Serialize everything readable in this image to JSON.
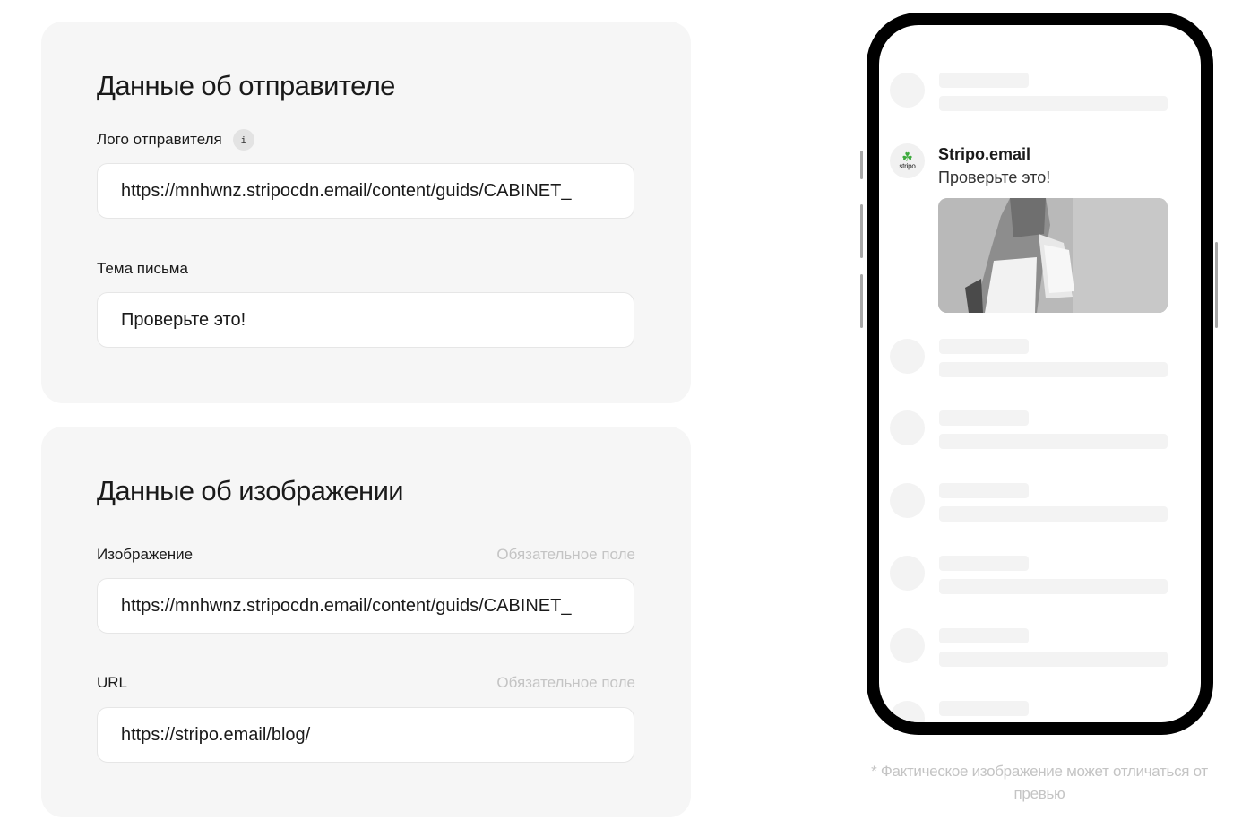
{
  "sender_section": {
    "title": "Данные об отправителе",
    "logo_label": "Лого отправителя",
    "logo_info_icon": "i",
    "logo_url": "https://mnhwnz.stripocdn.email/content/guids/CABINET_",
    "subject_label": "Тема письма",
    "subject_value": "Проверьте это!"
  },
  "image_section": {
    "title": "Данные об изображении",
    "image_label": "Изображение",
    "image_required": "Обязательное поле",
    "image_url": "https://mnhwnz.stripocdn.email/content/guids/CABINET_",
    "url_label": "URL",
    "url_required": "Обязательное поле",
    "url_value": "https://stripo.email/blog/"
  },
  "preview": {
    "sender_name": "Stripo.email",
    "subject": "Проверьте это!",
    "logo_text": "stripo",
    "logo_icon": "leaf-icon",
    "disclaimer": "* Фактическое изображение может отличаться от превью"
  }
}
